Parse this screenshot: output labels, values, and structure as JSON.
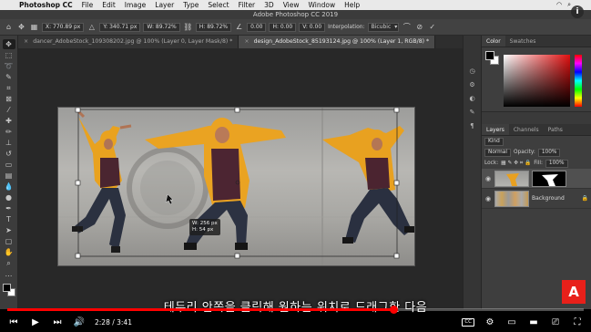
{
  "menubar": {
    "app": "Photoshop CC",
    "items": [
      "File",
      "Edit",
      "Image",
      "Layer",
      "Type",
      "Select",
      "Filter",
      "3D",
      "View",
      "Window",
      "Help"
    ]
  },
  "window_title": "Adobe Photoshop CC 2019",
  "options": {
    "x": "X: 770.89 px",
    "y": "Y: 340.71 px",
    "w": "W: 89.72%",
    "h": "H: 89.72%",
    "angle": "0.00",
    "h_skew": "H: 0.00",
    "v_skew": "V: 0.00",
    "interpolation_label": "Interpolation:",
    "interpolation": "Bicubic"
  },
  "tabs": [
    {
      "label": "dancer_AdobeStock_109308202.jpg @ 100% (Layer 0, Layer Mask/8) *",
      "close": "×"
    },
    {
      "label": "design_AdobeStock_85193124.jpg @ 100% (Layer 1, RGB/8) *",
      "close": "×"
    }
  ],
  "transform_readout": {
    "width": "W: 256 px",
    "height": "H: 54 px"
  },
  "color_panel": {
    "tabs": [
      "Color",
      "Swatches"
    ]
  },
  "layers_panel": {
    "tabs": [
      "Layers",
      "Channels",
      "Paths"
    ],
    "kind": "Kind",
    "blend_mode": "Normal",
    "opacity_label": "Opacity:",
    "opacity": "100%",
    "lock_label": "Lock:",
    "fill_label": "Fill:",
    "fill": "100%",
    "layers": [
      {
        "name": ""
      },
      {
        "name": "Background"
      }
    ]
  },
  "video": {
    "subtitle": "테두리 안쪽을 클릭해 원하는 위치로 드래그한 다음",
    "current_time": "2:28",
    "duration": "3:41",
    "time_display": "2:28 / 3:41",
    "progress": 0.67,
    "logo": "A"
  },
  "colors": {
    "accent_red": "#ff0000",
    "adobe_red": "#e8201a",
    "hoodie_yellow": "#e8a020"
  }
}
